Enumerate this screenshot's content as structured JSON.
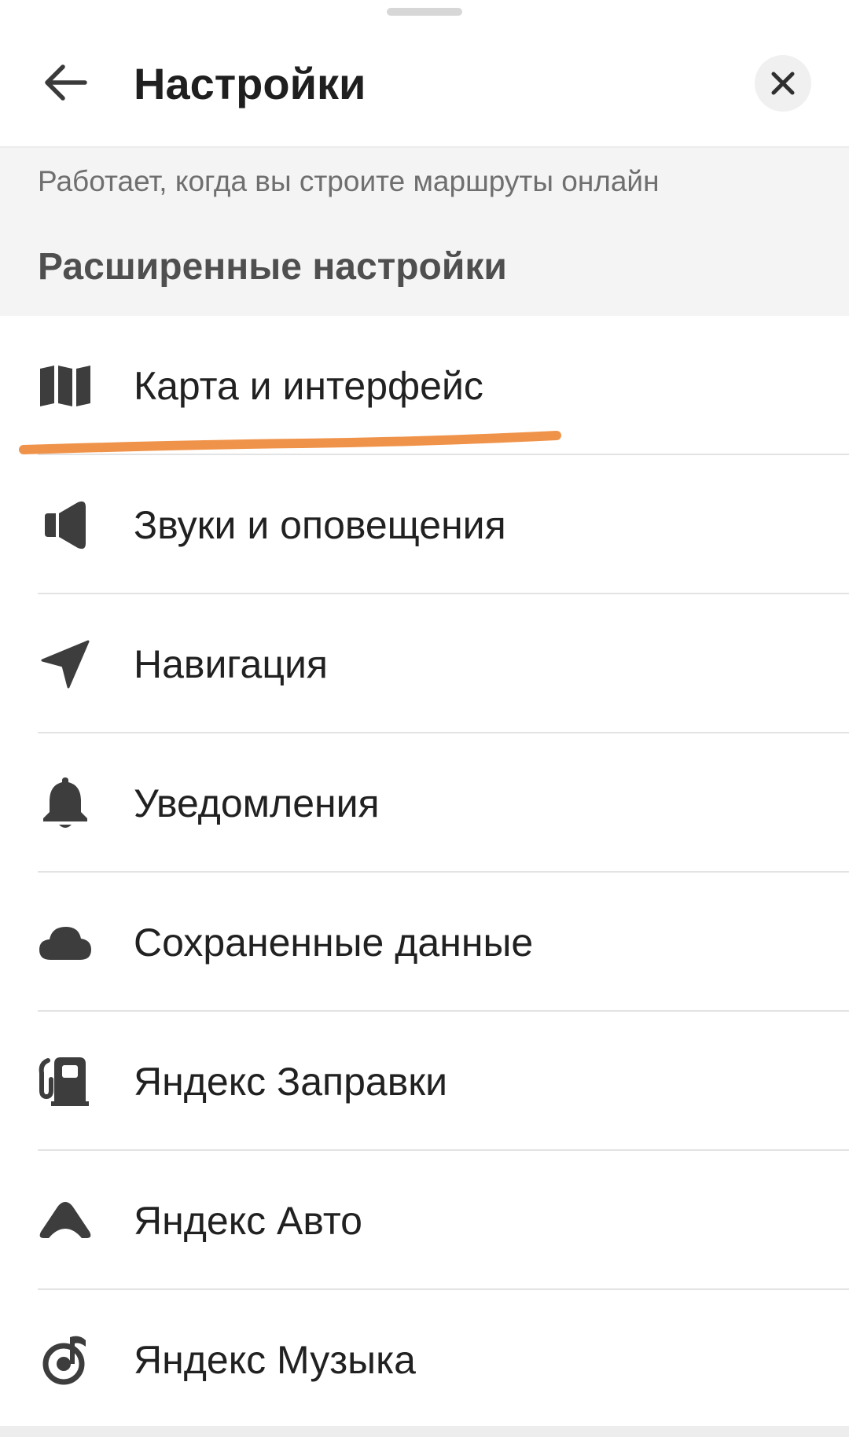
{
  "header": {
    "title": "Настройки",
    "back_icon": "arrow-left-icon",
    "close_icon": "close-icon"
  },
  "hint": "Работает, когда вы строите маршруты онлайн",
  "section_title": "Расширенные настройки",
  "items": [
    {
      "label": "Карта и интерфейс",
      "icon": "map-icon"
    },
    {
      "label": "Звуки и оповещения",
      "icon": "speaker-icon"
    },
    {
      "label": "Навигация",
      "icon": "navigation-arrow-icon"
    },
    {
      "label": "Уведомления",
      "icon": "bell-icon"
    },
    {
      "label": "Сохраненные данные",
      "icon": "cloud-icon"
    },
    {
      "label": "Яндекс Заправки",
      "icon": "fuel-pump-icon"
    },
    {
      "label": "Яндекс Авто",
      "icon": "yandex-auto-icon"
    },
    {
      "label": "Яндекс Музыка",
      "icon": "music-note-icon"
    }
  ],
  "colors": {
    "text": "#212121",
    "icon": "#3d3d3d",
    "highlight_underline": "#f0934a",
    "gray_background": "#f4f4f4"
  }
}
